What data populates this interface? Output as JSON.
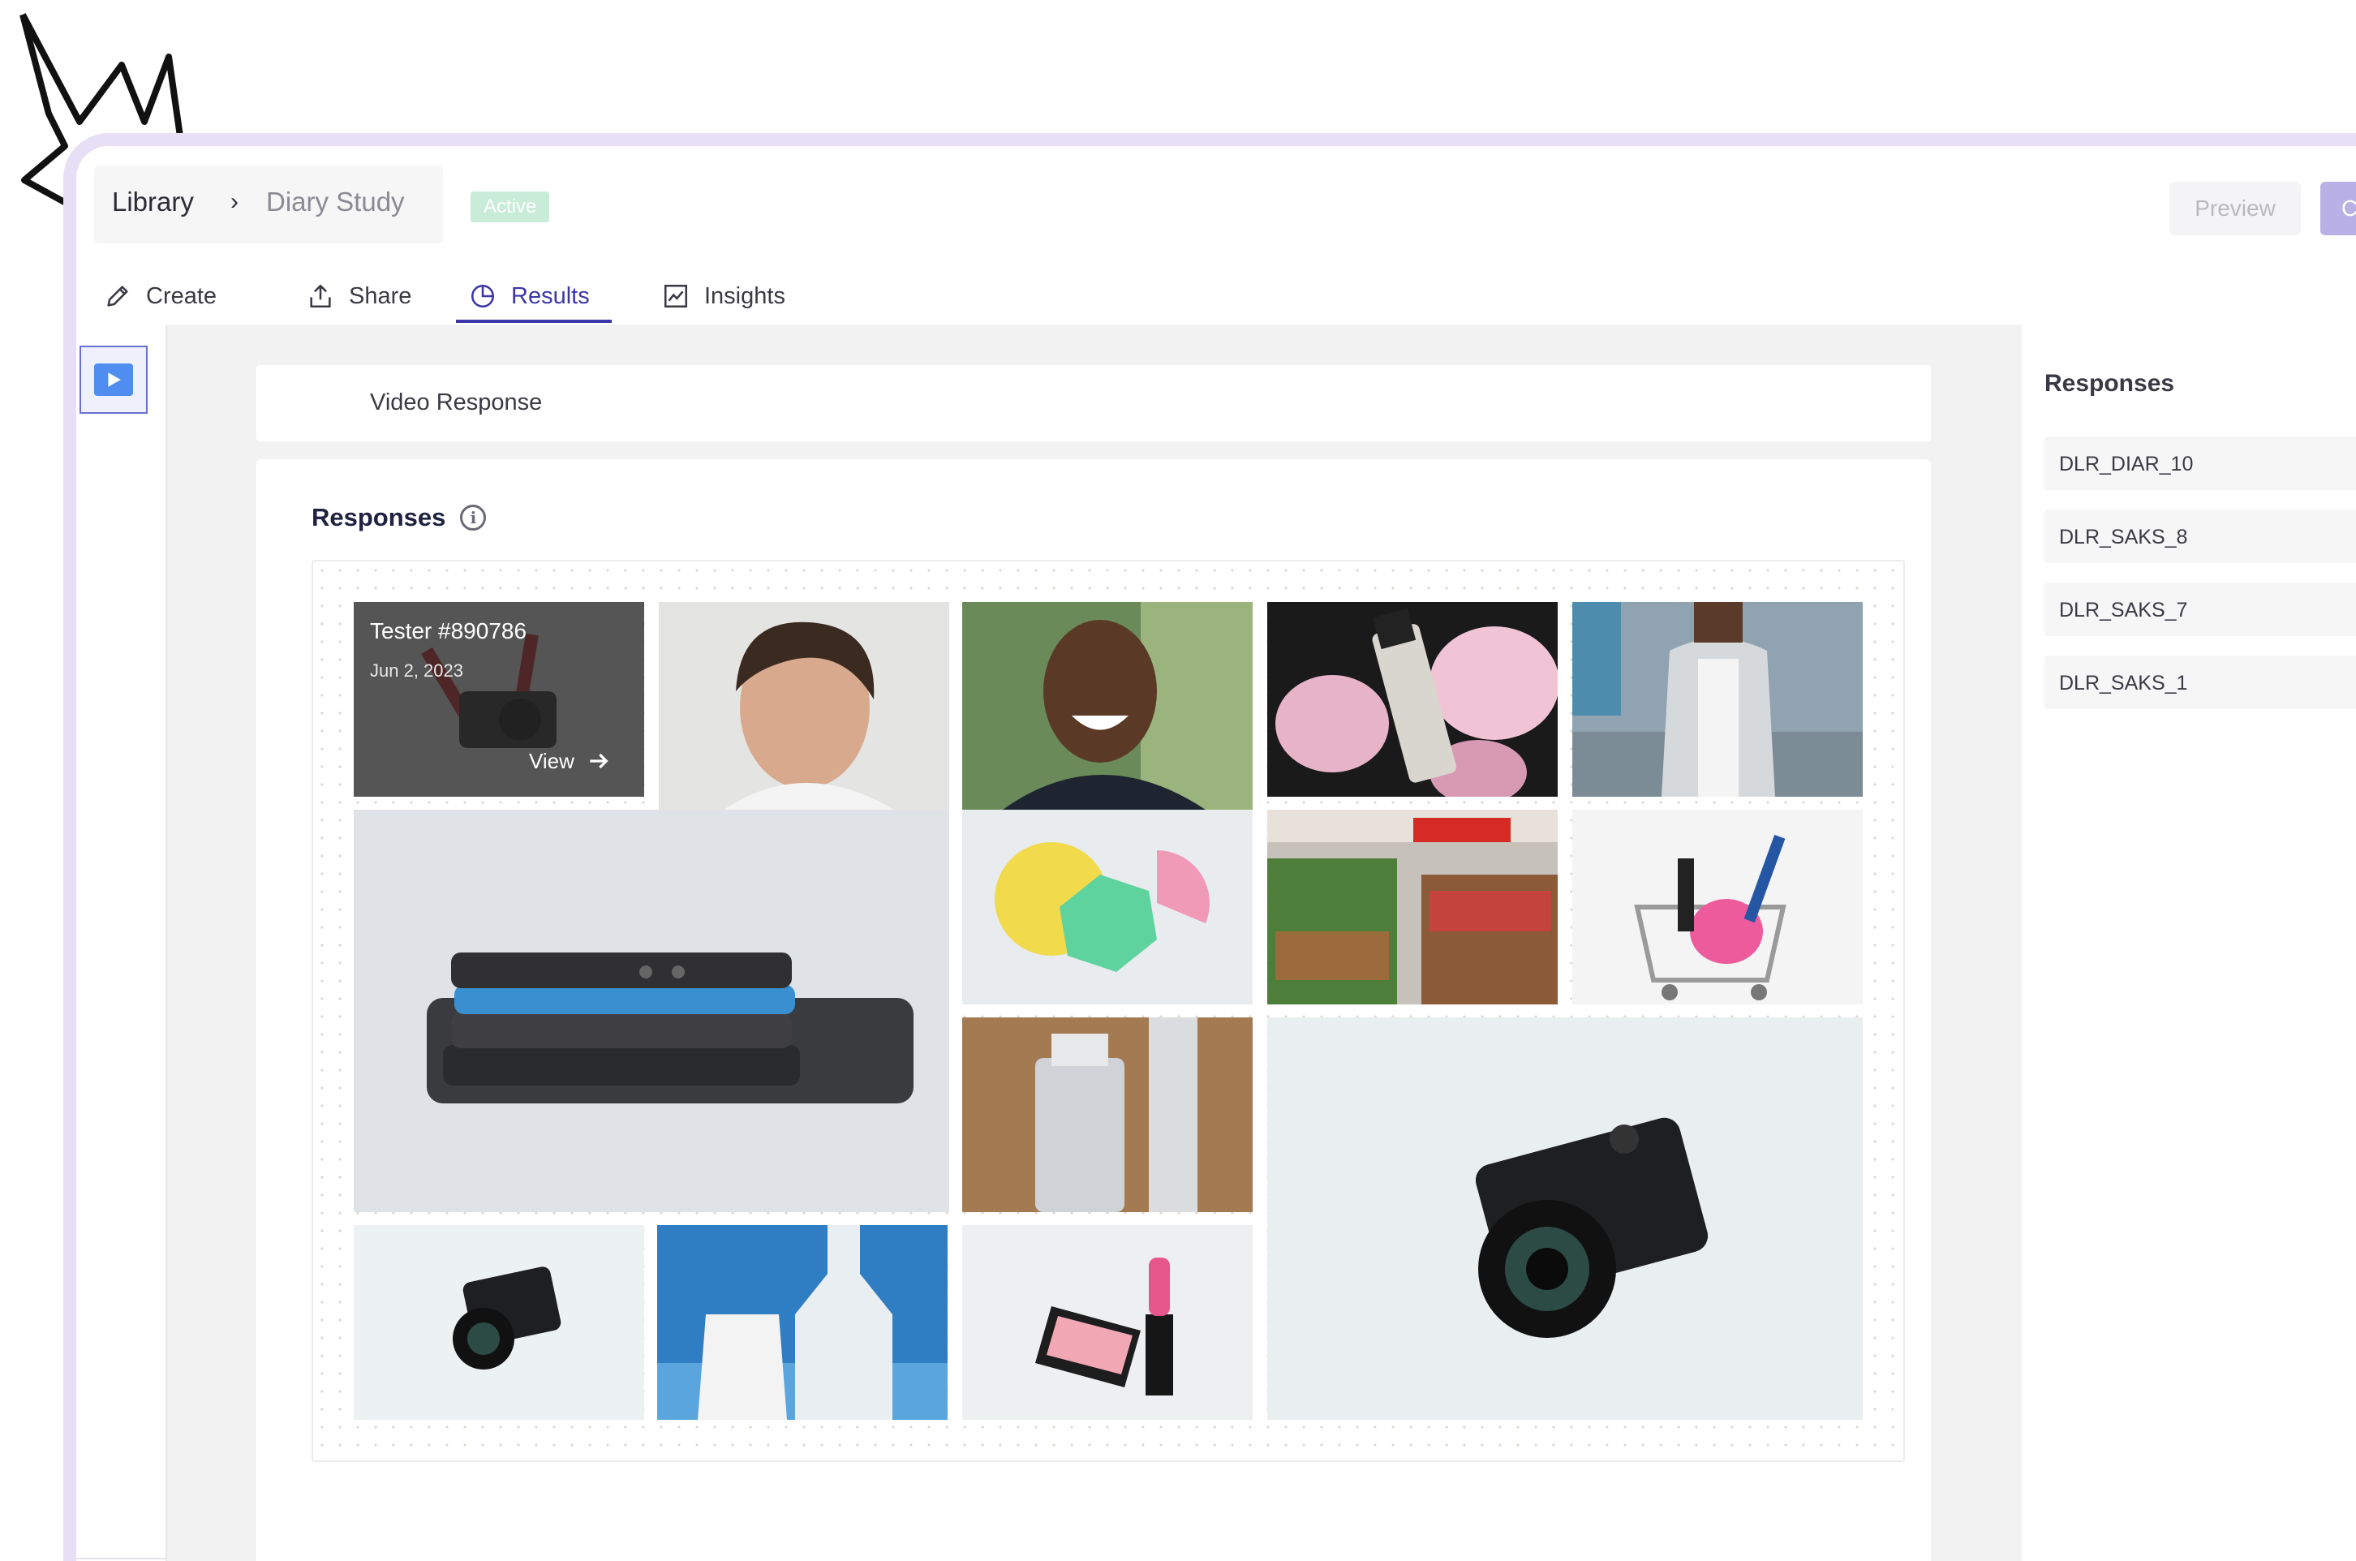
{
  "breadcrumb": {
    "library": "Library",
    "separator": "›",
    "current": "Diary Study"
  },
  "status_badge": "Active",
  "header_buttons": {
    "preview": "Preview",
    "publish": "C"
  },
  "tabs": [
    {
      "label": "Create",
      "icon": "pencil-icon"
    },
    {
      "label": "Share",
      "icon": "share-icon"
    },
    {
      "label": "Results",
      "icon": "pie-chart-icon",
      "active": true
    },
    {
      "label": "Insights",
      "icon": "line-chart-icon"
    }
  ],
  "question": {
    "title": "Video Response"
  },
  "responses_section": {
    "title": "Responses",
    "info_glyph": "i",
    "featured": {
      "tester": "Tester #890786",
      "date": "Jun 2, 2023",
      "view_label": "View"
    }
  },
  "side_panel": {
    "title": "Responses",
    "items": [
      "DLR_DIAR_10",
      "DLR_SAKS_8",
      "DLR_SAKS_7",
      "DLR_SAKS_1"
    ]
  },
  "colors": {
    "accent": "#3c36a8",
    "frame": "#e6dff5",
    "badge": "#c9ecd9",
    "publish": "#b9b1e6"
  }
}
